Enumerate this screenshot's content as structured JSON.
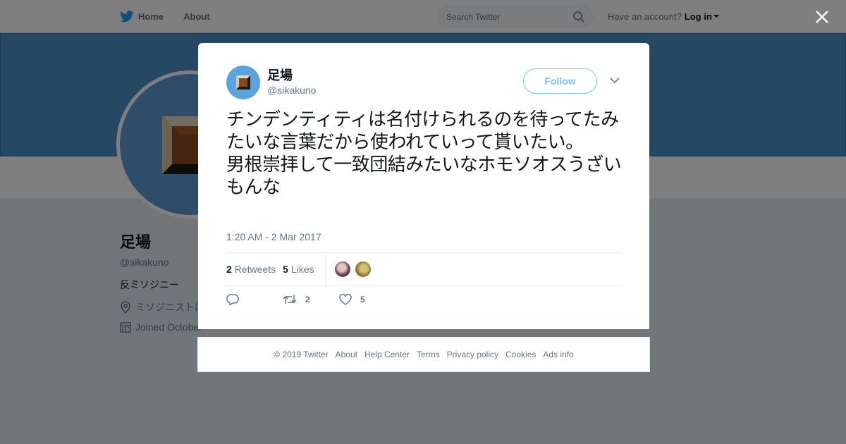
{
  "nav": {
    "home_label": "Home",
    "about_label": "About",
    "search_placeholder": "Search Twitter",
    "account_prompt": "Have an account?",
    "login_label": "Log in"
  },
  "profile": {
    "name": "足場",
    "handle": "@sikakuno",
    "bio": "反ミソジニー",
    "location": "ミソジニストは",
    "joined": "Joined October"
  },
  "tweet": {
    "author_name": "足場",
    "author_handle": "@sikakuno",
    "follow_label": "Follow",
    "text": "チンデンティティは名付けられるのを待ってたみたいな言葉だから使われていって貰いたい。\n男根崇拝して一致団結みたいなホモソオスうざいもんな",
    "timestamp": "1:20 AM - 2 Mar 2017",
    "retweet_count": "2",
    "retweets_label": "Retweets",
    "like_count": "5",
    "likes_label": "Likes",
    "action_retweet_count": "2",
    "action_like_count": "5"
  },
  "footer": {
    "links": [
      "© 2019 Twitter",
      "About",
      "Help Center",
      "Terms",
      "Privacy policy",
      "Cookies",
      "Ads info"
    ]
  },
  "colors": {
    "twitter_blue": "#1da1f2",
    "banner": "#4a90c7",
    "avatar_bg": "#5ba3e0"
  }
}
